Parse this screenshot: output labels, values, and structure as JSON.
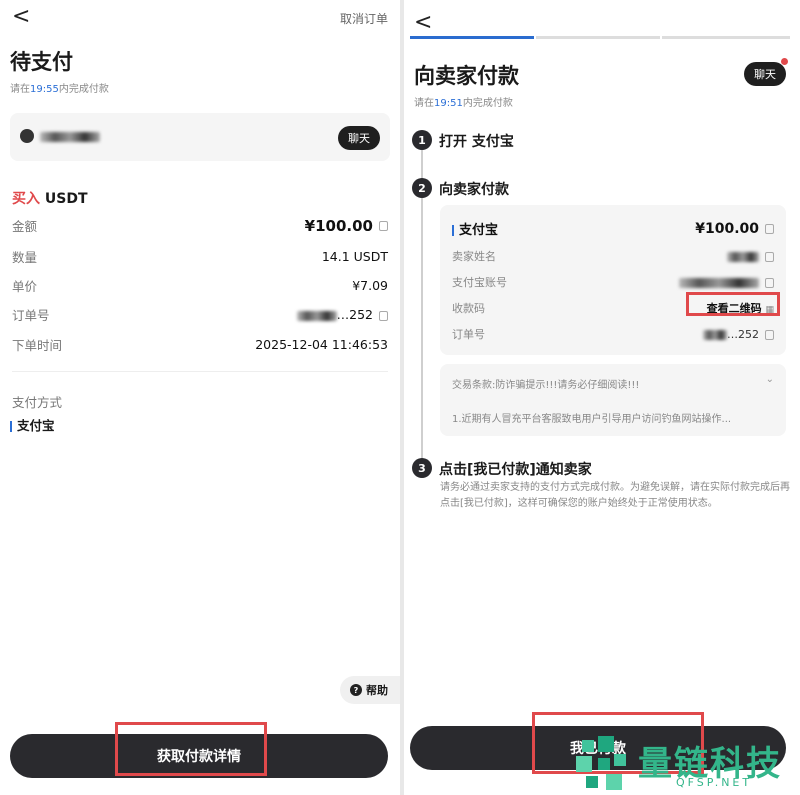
{
  "left": {
    "back": "<",
    "cancel_order": "取消订单",
    "title": "待支付",
    "countdown_prefix": "请在",
    "countdown_time": "19:55",
    "countdown_suffix": "内完成付款",
    "chat_label": "聊天",
    "trade_type": "买入",
    "trade_coin": "USDT",
    "rows": [
      {
        "key": "金额",
        "value": "¥100.00"
      },
      {
        "key": "数量",
        "value": "14.1 USDT"
      },
      {
        "key": "单价",
        "value": "¥7.09"
      },
      {
        "key": "订单号",
        "value": "…252"
      },
      {
        "key": "下单时间",
        "value": "2025-12-04 11:46:53"
      }
    ],
    "payment_method_label": "支付方式",
    "payment_method": "支付宝",
    "help_label": "帮助",
    "help_icon": "?",
    "primary_button": "获取付款详情"
  },
  "right": {
    "back": "<",
    "title": "向卖家付款",
    "chat_label": "聊天",
    "countdown_prefix": "请在",
    "countdown_time": "19:51",
    "countdown_suffix": "内完成付款",
    "steps": [
      {
        "num": "1",
        "title": "打开 支付宝"
      },
      {
        "num": "2",
        "title": "向卖家付款"
      },
      {
        "num": "3",
        "title": "点击[我已付款]通知卖家"
      }
    ],
    "card": {
      "method": "支付宝",
      "amount": "¥100.00",
      "seller_name_label": "卖家姓名",
      "account_label": "支付宝账号",
      "qr_label": "收款码",
      "qr_action": "查看二维码",
      "order_label": "订单号",
      "order_value": "…252"
    },
    "terms_title": "交易条款:防诈骗提示!!!请务必仔细阅读!!!",
    "terms_body": "1.近期有人冒充平台客服致电用户引导用户访问钓鱼网站操作...",
    "step3_desc": "请务必通过卖家支持的支付方式完成付款。为避免误解，请在实际付款完成后再点击[我已付款]，这样可确保您的账户始终处于正常使用状态。",
    "primary_button": "我已付款"
  },
  "watermark": {
    "text": "量链科技",
    "sub": "QFSP.NET"
  },
  "colors": {
    "accent_blue": "#2b6fd6",
    "buy_red": "#e0494b",
    "button_dark": "#2a2a2e"
  }
}
